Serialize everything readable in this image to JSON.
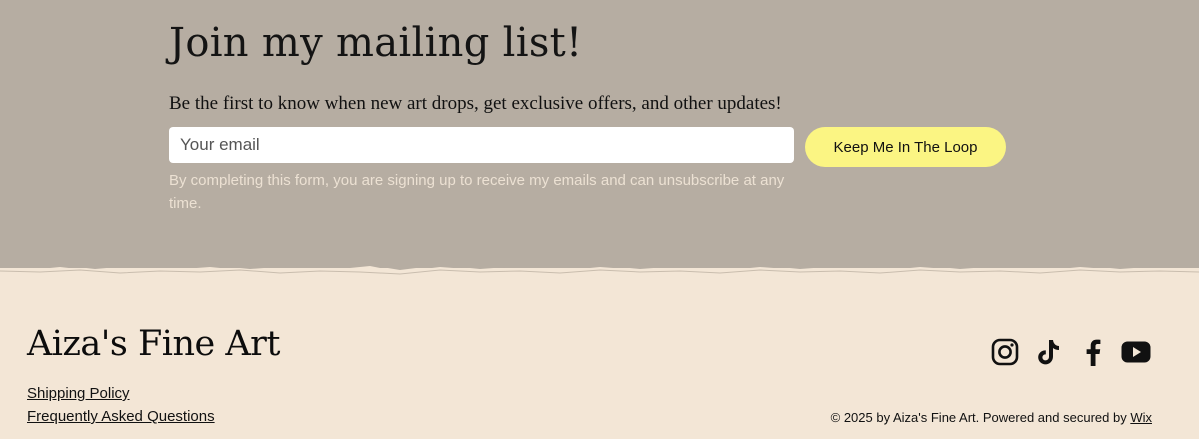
{
  "signup": {
    "title": "Join my mailing list!",
    "subtitle": "Be the first to know when new art drops, get exclusive offers, and other updates!",
    "email_placeholder": "Your email",
    "email_value": "",
    "button_label": "Keep Me In The Loop",
    "disclaimer": "By completing this form, you are signing up to receive my emails and can unsubscribe at any time."
  },
  "footer": {
    "brand": "Aiza's Fine Art",
    "links": [
      "Shipping Policy",
      "Frequently Asked Questions"
    ],
    "social": [
      "instagram-icon",
      "tiktok-icon",
      "facebook-icon",
      "youtube-icon"
    ],
    "copyright_prefix": "© 2025 by Aiza's Fine Art. Powered and secured by ",
    "copyright_link": "Wix"
  },
  "colors": {
    "signup_bg": "#b6ada2",
    "footer_bg": "#f3e6d6",
    "button_bg": "#fbf583",
    "disclaimer_text": "#ece1d3"
  }
}
